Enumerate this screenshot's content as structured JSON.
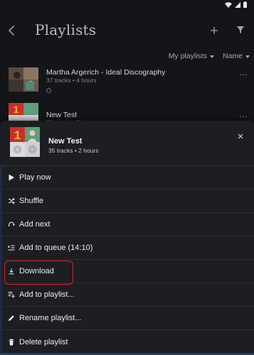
{
  "app": {
    "title": "Playlists",
    "sort": {
      "filter_label": "My playlists",
      "order_label": "Name"
    }
  },
  "playlists": [
    {
      "title": "Martha Argerich - Ideal Discography",
      "subtitle": "37 tracks • 4 hours"
    },
    {
      "title": "New Test",
      "subtitle": "35 tracks • 2 hours"
    }
  ],
  "sheet": {
    "title": "New Test",
    "subtitle": "35 tracks • 2 hours",
    "actions": [
      {
        "label": "Play now",
        "icon": "play-icon"
      },
      {
        "label": "Shuffle",
        "icon": "shuffle-icon"
      },
      {
        "label": "Add next",
        "icon": "add-next-icon"
      },
      {
        "label": "Add to queue (14:10)",
        "icon": "queue-icon"
      },
      {
        "label": "Download",
        "icon": "download-icon"
      },
      {
        "label": "Add to playlist...",
        "icon": "add-to-playlist-icon"
      },
      {
        "label": "Rename playlist...",
        "icon": "pencil-icon"
      },
      {
        "label": "Delete playlist",
        "icon": "trash-icon"
      }
    ]
  },
  "colors": {
    "background": "#141519",
    "sheet": "#1d1e22",
    "highlight": "#e0222b",
    "thumb_red": "#c8302c",
    "thumb_yellow": "#f2b928",
    "thumb_green": "#5f9e7e"
  }
}
